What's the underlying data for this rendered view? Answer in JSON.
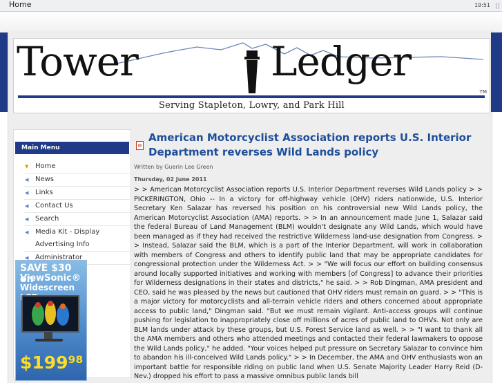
{
  "browser": {
    "title": "Home",
    "clock": "19:51"
  },
  "masthead": {
    "word1": "Tower",
    "word2": "Ledger",
    "trademark": "TM",
    "tagline": "Serving Stapleton, Lowry, and Park Hill"
  },
  "sidebar": {
    "menu_title": "Main Menu",
    "items": [
      {
        "label": "Home",
        "active": true
      },
      {
        "label": "News",
        "active": false
      },
      {
        "label": "Links",
        "active": false
      },
      {
        "label": "Contact Us",
        "active": false
      },
      {
        "label": "Search",
        "active": false
      },
      {
        "label": "Media Kit - Display Advertising Info",
        "active": false
      },
      {
        "label": "Administrator",
        "active": false
      }
    ],
    "ad": {
      "line1": "SAVE $30 on",
      "line2": "ViewSonic®",
      "line3": "Widescreen LCD",
      "price": "$199⁹⁸"
    }
  },
  "article": {
    "title": "American Motorcyclist Association reports U.S. Interior Department reverses Wild Lands policy",
    "byline": "Written by Guerin Lee Green",
    "date": "Thursday, 02 June 2011",
    "body": "> > American Motorcyclist Association reports U.S. Interior Department reverses Wild Lands policy > > PICKERINGTON, Ohio -- In a victory for off-highway vehicle (OHV) riders nationwide, U.S. Interior Secretary Ken Salazar has reversed his position on his controversial new Wild Lands policy, the American Motorcyclist Association (AMA) reports. > > In an announcement made June 1, Salazar said the federal Bureau of Land Management (BLM) wouldn't designate any Wild Lands, which would have been managed as if they had received the restrictive Wilderness land-use designation from Congress. > > Instead, Salazar said the BLM, which is a part of the Interior Department, will work in collaboration with members of Congress and others to identify public land that may be appropriate candidates for congressional protection under the Wilderness Act. > > \"We will focus our effort on building consensus around locally supported initiatives and working with members [of Congress] to advance their priorities for Wilderness designations in their states and districts,\" he said. > > Rob Dingman, AMA president and CEO, said he was pleased by the news but cautioned that OHV riders must remain on guard. > > \"This is a major victory for motorcyclists and all-terrain vehicle riders and others concerned about appropriate access to public land,\" Dingman said. \"But we must remain vigilant. Anti-access groups will continue pushing for legislation to inappropriately close off millions of acres of public land to OHVs. Not only are BLM lands under attack by these groups, but U.S. Forest Service land as well. > > \"I want to thank all the AMA members and others who attended meetings and contacted their federal lawmakers to oppose the Wild Lands policy,\" he added. \"Your voices helped put pressure on Secretary Salazar to convince him to abandon his ill-conceived Wild Lands policy.\" > > In December, the AMA and OHV enthusiasts won an important battle for responsible riding on public land when U.S. Senate Majority Leader Harry Reid (D-Nev.) dropped his effort to pass a massive omnibus public lands bill"
  },
  "colors": {
    "navy": "#1f3a86",
    "link": "#1f4e99",
    "pdf": "#c23b22"
  }
}
